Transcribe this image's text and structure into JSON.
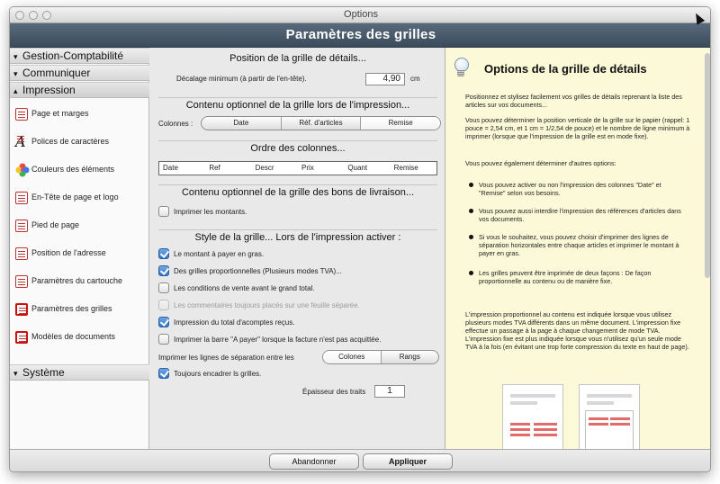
{
  "window": {
    "title": "Options"
  },
  "header": {
    "title": "Paramètres des grilles"
  },
  "sidebar": {
    "sections": [
      {
        "label": "Gestion-Comptabilité",
        "expanded": false
      },
      {
        "label": "Communiquer",
        "expanded": false
      },
      {
        "label": "Impression",
        "expanded": true
      },
      {
        "label": "Système",
        "expanded": false
      }
    ],
    "items": [
      {
        "label": "Page et marges",
        "icon": "page-icon"
      },
      {
        "label": "Polices de caractères",
        "icon": "font-icon"
      },
      {
        "label": "Couleurs des éléments",
        "icon": "color-flower-icon"
      },
      {
        "label": "En-Tête de page et logo",
        "icon": "header-icon"
      },
      {
        "label": "Pied de page",
        "icon": "footer-icon"
      },
      {
        "label": "Position de l'adresse",
        "icon": "address-icon"
      },
      {
        "label": "Paramètres du cartouche",
        "icon": "cartouche-icon"
      },
      {
        "label": "Paramètres des grilles",
        "icon": "grid-icon"
      },
      {
        "label": "Modèles de documents",
        "icon": "templates-icon"
      }
    ]
  },
  "main": {
    "position": {
      "title": "Position de la grille de détails...",
      "offset_label": "Décalage minimum (à partir de l'en-tête).",
      "offset_value": "4,90",
      "unit": "cm"
    },
    "optional_content": {
      "title": "Contenu optionnel de la grille lors de l'impression...",
      "columns_label": "Colonnes :",
      "segments": [
        "Date",
        "Réf. d'articles",
        "Remise"
      ]
    },
    "order": {
      "title": "Ordre des colonnes...",
      "columns": [
        "Date",
        "Ref",
        "Descr",
        "Prix",
        "Quant",
        "Remise"
      ]
    },
    "delivery": {
      "title": "Contenu optionnel de la grille des bons de livraison...",
      "print_amounts": "Imprimer les montants."
    },
    "style": {
      "title": "Style de la grille... Lors de l'impression activer :",
      "options": [
        {
          "label": "Le montant à payer en gras.",
          "checked": true,
          "disabled": false
        },
        {
          "label": "Des grilles proportionnelles (Plusieurs modes TVA)...",
          "checked": true,
          "disabled": false
        },
        {
          "label": "Les conditions de vente avant le grand total.",
          "checked": false,
          "disabled": false
        },
        {
          "label": "Les commentaires toujours placés sur une feuille séparée.",
          "checked": false,
          "disabled": true
        },
        {
          "label": "Impression du total d'acomptes reçus.",
          "checked": true,
          "disabled": false
        },
        {
          "label": "Imprimer la barre \"A payer\" lorsque la facture n'est pas acquittée.",
          "checked": false,
          "disabled": false
        }
      ],
      "separator_label": "Imprimer les lignes de séparation entre les",
      "separator_segments": [
        "Colones",
        "Rangs"
      ],
      "frame_label": "Toujours encadrer ls grilles.",
      "thickness_label": "Épaisseur des traits",
      "thickness_value": "1"
    }
  },
  "help": {
    "title": "Options de la grille de détails",
    "p1": "Positionnez et stylisez facilement vos grilles de détails reprenant la liste des articles sur vos documents...",
    "p2": "Vous pouvez déterminer la position verticale de la grille sur le papier (rappel: 1 pouce = 2,54 cm, et 1 cm = 1/2,54 de pouce) et le nombre de ligne minimum à imprimer (lorsque que l'impression de la grille est en mode fixe).",
    "p3": "Vous pouvez également déterminer d'autres options:",
    "bullets": [
      "Vous pouvez activer ou non l'impression des colonnes \"Date\" et \"Remise\" selon vos besoins.",
      "Vous pouvez aussi interdire l'impression des références d'articles dans vos documents.",
      "Si vous le souhaitez, vous pouvez choisir d'imprimer des lignes de séparation horizontales entre chaque articles et imprimer  le montant à payer en gras.",
      "Les grilles peuvent être imprimée de deux façons :  De façon proportionnelle au contenu ou de manière fixe."
    ],
    "p4": "L'impression proportionnel au contenu est indiquée lorsque vous utilisez plusieurs modes TVA différents dans un même document. L'impression fixe effectue un passage à la page à chaque changement de mode TVA. L'impression fixe est plus indiquée lorsque vous n'utilisez qu'un seule mode TVA à la fois (en évitant une trop forte compression du texte en haut de page)."
  },
  "footer": {
    "cancel": "Abandonner",
    "apply": "Appliquer"
  },
  "colors": {
    "header": "#46576a",
    "help_bg": "#fbf9d7",
    "check_blue": "#2f75c7"
  }
}
